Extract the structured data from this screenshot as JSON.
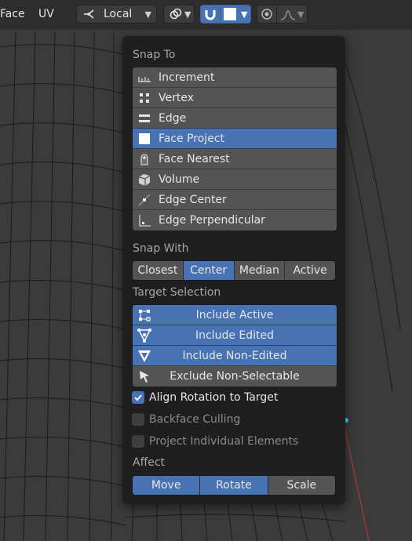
{
  "header": {
    "mode_label": "Face",
    "uv_label": "UV",
    "pivot_value": "Local",
    "snap_chevron": "⌄"
  },
  "popover": {
    "snap_to": {
      "label": "Snap To",
      "items": [
        {
          "label": "Increment",
          "icon": "increment-icon"
        },
        {
          "label": "Vertex",
          "icon": "vertex-icon"
        },
        {
          "label": "Edge",
          "icon": "edge-icon"
        },
        {
          "label": "Face Project",
          "icon": "face-project-icon",
          "selected": true
        },
        {
          "label": "Face Nearest",
          "icon": "face-nearest-icon"
        },
        {
          "label": "Volume",
          "icon": "volume-icon"
        },
        {
          "label": "Edge Center",
          "icon": "edge-center-icon"
        },
        {
          "label": "Edge Perpendicular",
          "icon": "edge-perpendicular-icon"
        }
      ]
    },
    "snap_with": {
      "label": "Snap With",
      "options": [
        "Closest",
        "Center",
        "Median",
        "Active"
      ],
      "selected": "Center"
    },
    "target_selection": {
      "label": "Target Selection",
      "items": [
        {
          "label": "Include Active",
          "on": true
        },
        {
          "label": "Include Edited",
          "on": true
        },
        {
          "label": "Include Non-Edited",
          "on": true
        },
        {
          "label": "Exclude Non-Selectable",
          "on": false
        }
      ]
    },
    "checkboxes": [
      {
        "label": "Align Rotation to Target",
        "checked": true,
        "enabled": true
      },
      {
        "label": "Backface Culling",
        "checked": false,
        "enabled": false
      },
      {
        "label": "Project Individual Elements",
        "checked": false,
        "enabled": false
      }
    ],
    "affect": {
      "label": "Affect",
      "options": [
        "Move",
        "Rotate",
        "Scale"
      ],
      "on": [
        "Move",
        "Rotate"
      ]
    }
  },
  "colors": {
    "accent": "#4772b3",
    "panel": "#1f1f1f",
    "item": "#545454"
  }
}
